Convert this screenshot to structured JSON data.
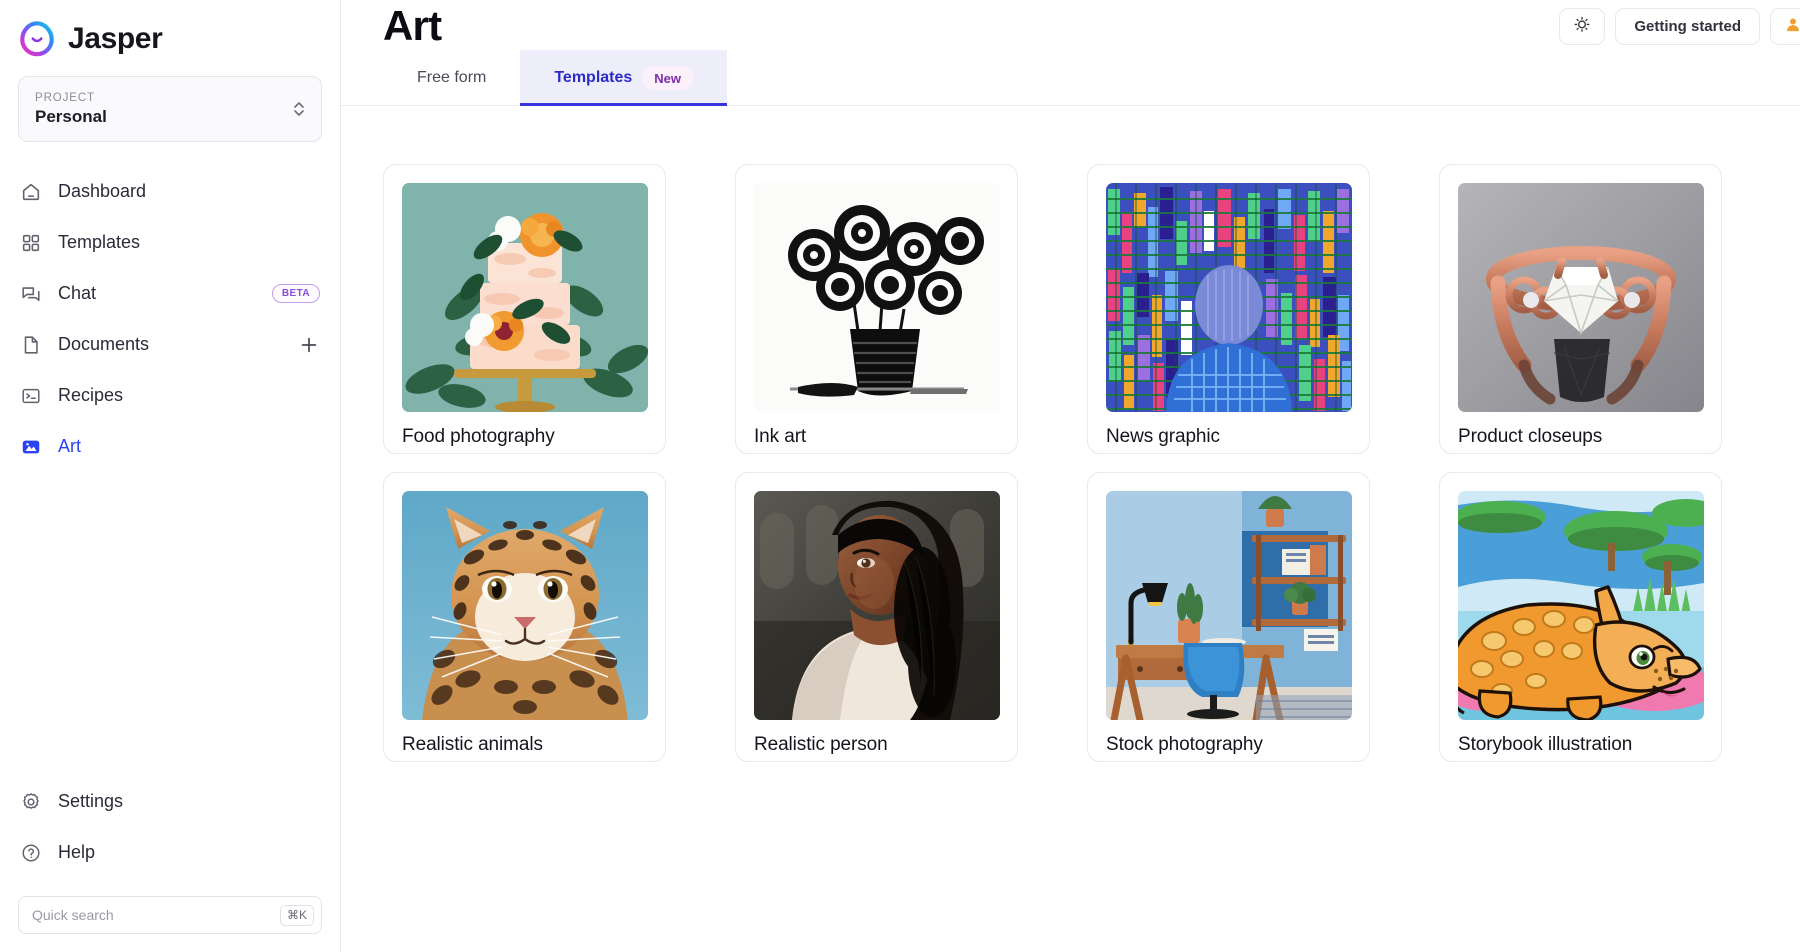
{
  "brand": {
    "name": "Jasper",
    "logo_icon": "jasper-logo-icon"
  },
  "project": {
    "label": "PROJECT",
    "value": "Personal",
    "chevron_icon": "chevron-up-down-icon"
  },
  "sidebar": {
    "items": [
      {
        "label": "Dashboard",
        "icon": "home-icon",
        "active": false
      },
      {
        "label": "Templates",
        "icon": "grid-icon",
        "active": false
      },
      {
        "label": "Chat",
        "icon": "chat-bubble-icon",
        "active": false,
        "badge": "BETA"
      },
      {
        "label": "Documents",
        "icon": "document-icon",
        "active": false,
        "action_icon": "plus-icon"
      },
      {
        "label": "Recipes",
        "icon": "terminal-icon",
        "active": false
      },
      {
        "label": "Art",
        "icon": "image-icon",
        "active": true
      }
    ],
    "bottom_items": [
      {
        "label": "Settings",
        "icon": "gear-icon"
      },
      {
        "label": "Help",
        "icon": "question-circle-icon"
      }
    ],
    "quick_search": {
      "placeholder": "Quick search",
      "value": "",
      "shortcut": "⌘K",
      "icon": "search-input"
    }
  },
  "header": {
    "title": "Art",
    "lightbulb_icon": "lightbulb-icon",
    "getting_started_label": "Getting started",
    "avatar_icon": "avatar-icon"
  },
  "tabs": [
    {
      "label": "Free form",
      "active": false,
      "badge": null
    },
    {
      "label": "Templates",
      "active": true,
      "badge": "New"
    }
  ],
  "colors": {
    "accent_blue": "#2b43f5",
    "tab_active_bg": "#eeeefb",
    "tab_active_text": "#2b2bc9",
    "tab_underline": "#3a33e0",
    "badge_beta_border": "#c39cf0",
    "badge_beta_text": "#8b4fd8",
    "badge_new_bg": "#fcf0fb",
    "badge_new_text": "#7b2ea8",
    "border": "#e9e9ee"
  },
  "cards": [
    {
      "title": "Food photography",
      "thumb": "wedding-cake-photo"
    },
    {
      "title": "Ink art",
      "thumb": "black-ink-roses-vase"
    },
    {
      "title": "News graphic",
      "thumb": "figure-data-mosaic"
    },
    {
      "title": "Product closeups",
      "thumb": "rose-gold-diamond-ring"
    },
    {
      "title": "Realistic animals",
      "thumb": "ocelot-wildcat-portrait"
    },
    {
      "title": "Realistic person",
      "thumb": "woman-portrait"
    },
    {
      "title": "Stock photography",
      "thumb": "blue-home-office-desk"
    },
    {
      "title": "Storybook illustration",
      "thumb": "cartoon-triceratops"
    }
  ]
}
